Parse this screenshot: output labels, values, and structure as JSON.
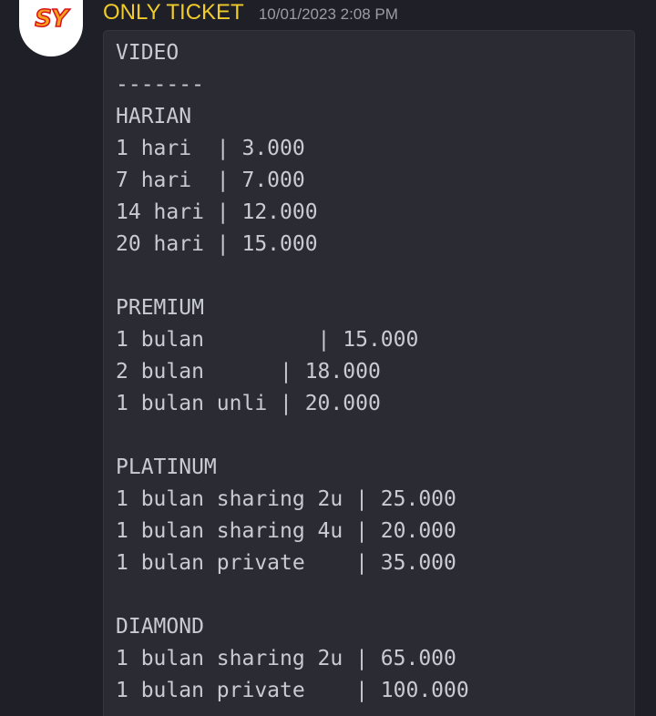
{
  "message": {
    "author": "ONLY TICKET",
    "timestamp": "10/01/2023 2:08 PM",
    "avatar_text": "SY",
    "colors": {
      "author": "#f0cc2a",
      "timestamp": "#9b9ca4",
      "code_text": "#c9cbd3",
      "code_background": "#2a2b33",
      "page_background": "#1f1f27"
    },
    "code_lines": [
      "VIDEO",
      "-------",
      "HARIAN",
      "1 hari  | 3.000",
      "7 hari  | 7.000",
      "14 hari | 12.000",
      "20 hari | 15.000",
      "",
      "PREMIUM",
      "1 bulan         | 15.000",
      "2 bulan      | 18.000",
      "1 bulan unli | 20.000",
      "",
      "PLATINUM",
      "1 bulan sharing 2u | 25.000",
      "1 bulan sharing 4u | 20.000",
      "1 bulan private    | 35.000",
      "",
      "DIAMOND",
      "1 bulan sharing 2u | 65.000",
      "1 bulan private    | 100.000"
    ]
  }
}
